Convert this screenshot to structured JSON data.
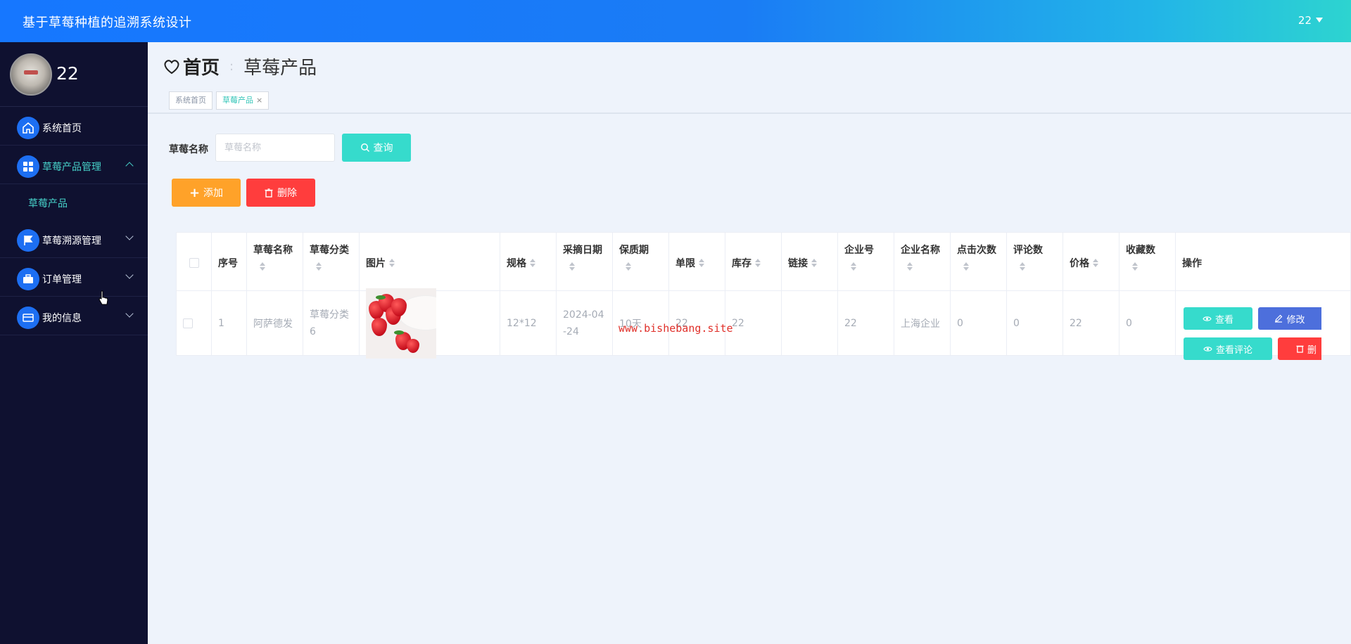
{
  "header": {
    "app_title": "基于草莓种植的追溯系统设计",
    "user": "22"
  },
  "sidebar": {
    "profile_name": "22",
    "items": [
      {
        "label": "系统首页",
        "icon": "home-icon"
      },
      {
        "label": "草莓产品管理",
        "icon": "grid-icon",
        "expanded": true,
        "children": [
          {
            "label": "草莓产品"
          }
        ]
      },
      {
        "label": "草莓溯源管理",
        "icon": "flag-icon"
      },
      {
        "label": "订单管理",
        "icon": "briefcase-icon"
      },
      {
        "label": "我的信息",
        "icon": "card-icon"
      }
    ]
  },
  "breadcrumb": {
    "home": "首页",
    "current": "草莓产品"
  },
  "tabs": [
    {
      "label": "系统首页"
    },
    {
      "label": "草莓产品",
      "active": true
    }
  ],
  "search": {
    "label": "草莓名称",
    "placeholder": "草莓名称",
    "button": "查询"
  },
  "actions": {
    "add": "添加",
    "delete": "删除"
  },
  "table": {
    "columns": [
      "序号",
      "草莓名称",
      "草莓分类",
      "图片",
      "规格",
      "采摘日期",
      "保质期",
      "单限",
      "库存",
      "链接",
      "企业号",
      "企业名称",
      "点击次数",
      "评论数",
      "价格",
      "收藏数",
      "操作"
    ],
    "rows": [
      {
        "index": "1",
        "name": "阿萨德发",
        "category": "草莓分类6",
        "spec": "12*12",
        "pick_date": "2024-04-24",
        "shelf_life": "10天",
        "limit": "22",
        "stock": "22",
        "link": "",
        "company_no": "22",
        "company_name": "上海企业",
        "clicks": "0",
        "comments": "0",
        "price": "22",
        "favorites": "0"
      }
    ],
    "row_actions": {
      "view": "查看",
      "edit": "修改",
      "comments": "查看评论",
      "delete": "删"
    }
  },
  "watermark": "www.bishebang.site",
  "colors": {
    "header_start": "#1677ff",
    "header_end": "#2dd4d0",
    "sidebar": "#0f1130",
    "accent": "#36dbcc",
    "warning": "#ffa229",
    "danger": "#ff3d3d",
    "primary": "#4d6fdc"
  }
}
